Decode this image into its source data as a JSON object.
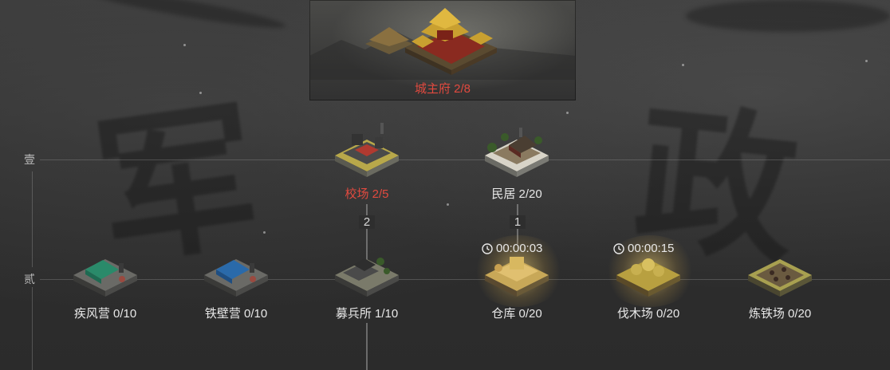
{
  "tiers": {
    "tier1": "壹",
    "tier2": "贰"
  },
  "main_hall": {
    "label": "城主府 2/8",
    "label_color": "#e24a3f"
  },
  "tier1_buildings": [
    {
      "name": "校场 2/5",
      "state": "locked-red"
    },
    {
      "name": "民居 2/20",
      "state": "normal"
    }
  ],
  "connectors": [
    {
      "number": "2"
    },
    {
      "number": "1"
    }
  ],
  "tier2_buildings": [
    {
      "name": "疾风营 0/10",
      "state": "normal"
    },
    {
      "name": "铁壁营 0/10",
      "state": "normal"
    },
    {
      "name": "募兵所 1/10",
      "state": "normal"
    },
    {
      "name": "仓库 0/20",
      "state": "building",
      "timer": "00:00:03"
    },
    {
      "name": "伐木场 0/20",
      "state": "building",
      "timer": "00:00:15"
    },
    {
      "name": "炼铁场 0/20",
      "state": "normal"
    }
  ],
  "background_glyphs": {
    "left": "军",
    "right": "政"
  },
  "colors": {
    "accent_red": "#e24a3f",
    "label_white": "#e8e8e8",
    "gold": "#d8b050"
  }
}
